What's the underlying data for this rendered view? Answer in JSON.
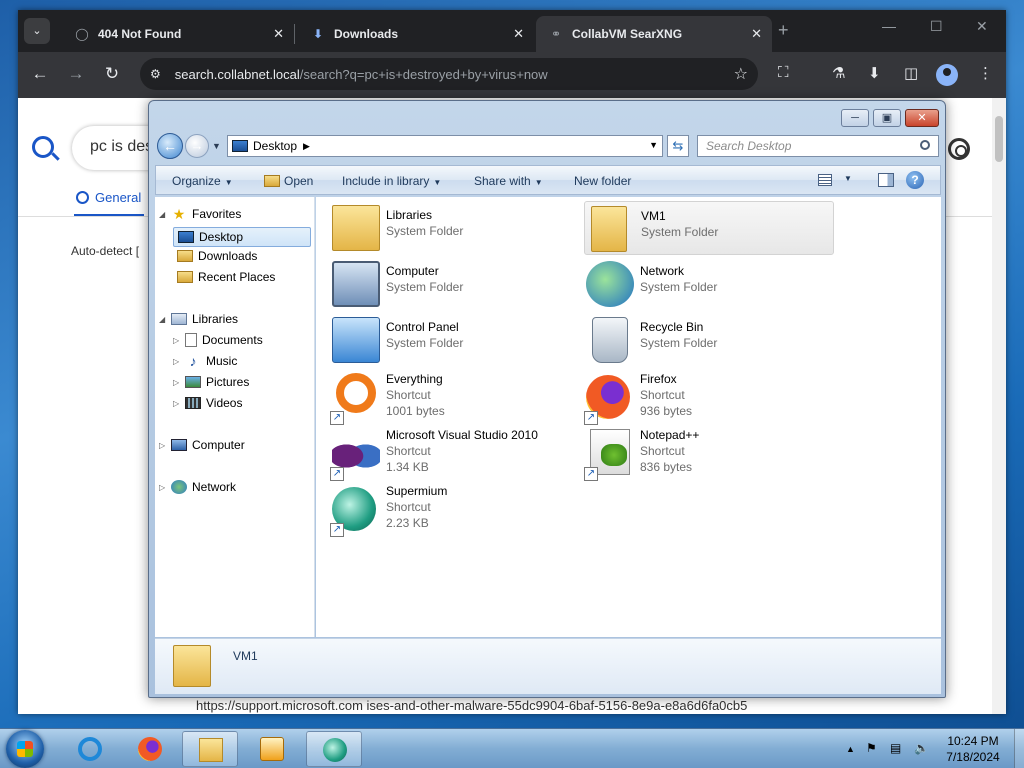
{
  "browser": {
    "tabs": [
      {
        "title": "404 Not Found",
        "icon": "globe-icon",
        "active": false
      },
      {
        "title": "Downloads",
        "icon": "download-icon",
        "active": false
      },
      {
        "title": "CollabVM SearXNG",
        "icon": "searxng-icon",
        "active": true
      }
    ],
    "url_host": "search.collabnet.local",
    "url_path": "/search?q=pc+is+destroyed+by+virus+now"
  },
  "searx": {
    "query_visible": "pc is des",
    "tab_general": "General",
    "autodetect": "Auto-detect [",
    "result_url": "https://support.microsoft.com  ises-and-other-malware-55dc9904-6baf-5156-8e9a-e8a6d6fa0cb5"
  },
  "explorer": {
    "address": "Desktop",
    "search_placeholder": "Search Desktop",
    "commands": {
      "organize": "Organize",
      "open": "Open",
      "include": "Include in library",
      "share": "Share with",
      "newfolder": "New folder"
    },
    "nav": {
      "favorites": "Favorites",
      "desktop": "Desktop",
      "downloads": "Downloads",
      "recent": "Recent Places",
      "libraries": "Libraries",
      "documents": "Documents",
      "music": "Music",
      "pictures": "Pictures",
      "videos": "Videos",
      "computer": "Computer",
      "network": "Network"
    },
    "items": [
      {
        "name": "Libraries",
        "type": "System Folder",
        "size": ""
      },
      {
        "name": "VM1",
        "type": "System Folder",
        "size": ""
      },
      {
        "name": "Computer",
        "type": "System Folder",
        "size": ""
      },
      {
        "name": "Network",
        "type": "System Folder",
        "size": ""
      },
      {
        "name": "Control Panel",
        "type": "System Folder",
        "size": ""
      },
      {
        "name": "Recycle Bin",
        "type": "System Folder",
        "size": ""
      },
      {
        "name": "Everything",
        "type": "Shortcut",
        "size": "1001 bytes"
      },
      {
        "name": "Firefox",
        "type": "Shortcut",
        "size": "936 bytes"
      },
      {
        "name": "Microsoft Visual Studio 2010",
        "type": "Shortcut",
        "size": "1.34 KB"
      },
      {
        "name": "Notepad++",
        "type": "Shortcut",
        "size": "836 bytes"
      },
      {
        "name": "Supermium",
        "type": "Shortcut",
        "size": "2.23 KB"
      }
    ],
    "selected_name": "VM1"
  },
  "taskbar": {
    "time": "10:24 PM",
    "date": "7/18/2024"
  }
}
